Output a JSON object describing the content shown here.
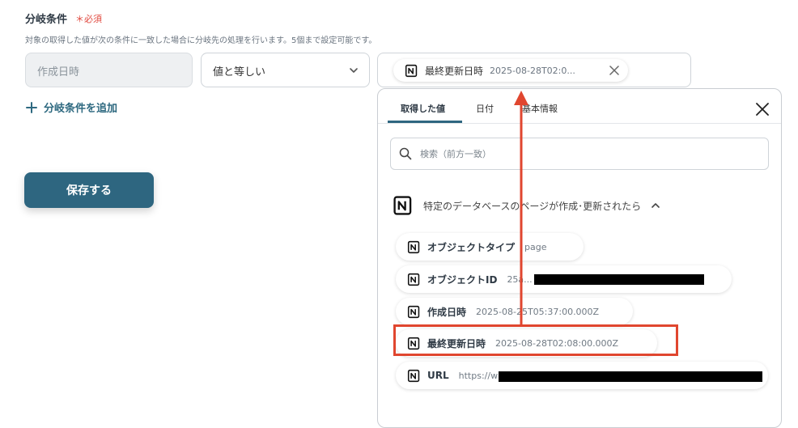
{
  "section": {
    "title": "分岐条件",
    "required": "＊必須",
    "description": "対象の取得した値が次の条件に一致した場合に分岐先の処理を行います。5個まで設定可能です。"
  },
  "condition": {
    "field": "作成日時",
    "operator": "値と等しい",
    "value_chip": {
      "name": "最終更新日時",
      "value": "2025-08-28T02:0..."
    }
  },
  "add_condition_label": "分岐条件を追加",
  "save_label": "保存する",
  "panel": {
    "tabs": [
      "取得した値",
      "日付",
      "基本情報"
    ],
    "active_tab": 0,
    "search_placeholder": "検索（前方一致）",
    "group_title": "特定のデータベースのページが作成･更新されたら",
    "items": [
      {
        "name": "オブジェクトタイプ",
        "value": "page"
      },
      {
        "name": "オブジェクトID",
        "value": "25a... 8"
      },
      {
        "name": "作成日時",
        "value": "2025-08-25T05:37:00.000Z"
      },
      {
        "name": "最終更新日時",
        "value": "2025-08-28T02:08:00.000Z"
      },
      {
        "name": "URL",
        "value": "https://w"
      }
    ]
  },
  "colors": {
    "accent": "#2e6680",
    "highlight": "#e0462f",
    "required": "#e0483e"
  }
}
